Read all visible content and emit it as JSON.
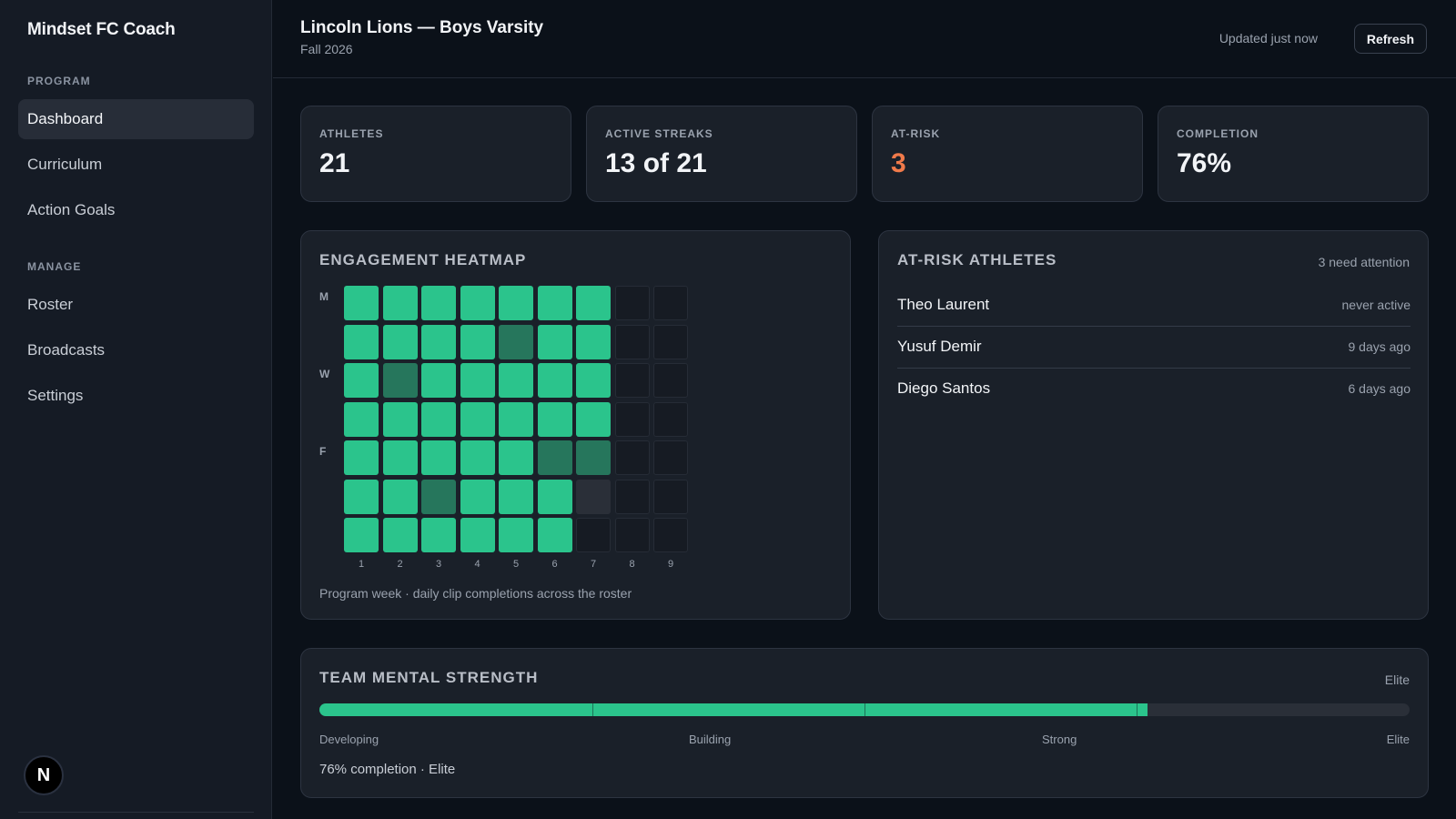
{
  "sidebar": {
    "brand": "Mindset FC Coach",
    "sections": [
      {
        "label": "PROGRAM",
        "items": [
          "Dashboard",
          "Curriculum",
          "Action Goals"
        ]
      },
      {
        "label": "MANAGE",
        "items": [
          "Roster",
          "Broadcasts",
          "Settings"
        ]
      }
    ],
    "active_item": "Dashboard",
    "avatar_initial": "N"
  },
  "header": {
    "title": "Lincoln Lions — Boys Varsity",
    "subtitle": "Fall 2026",
    "updated": "Updated just now",
    "refresh_label": "Refresh"
  },
  "stats": [
    {
      "label": "ATHLETES",
      "value": "21"
    },
    {
      "label": "ACTIVE STREAKS",
      "value": "13 of 21"
    },
    {
      "label": "AT-RISK",
      "value": "3"
    },
    {
      "label": "COMPLETION",
      "value": "76%"
    }
  ],
  "heatmap": {
    "title": "ENGAGEMENT HEATMAP",
    "day_labels": [
      "M",
      "",
      "W",
      "",
      "F",
      "",
      ""
    ],
    "week_labels": [
      "1",
      "2",
      "3",
      "4",
      "5",
      "6",
      "7",
      "8",
      "9"
    ],
    "levels": [
      [
        2,
        2,
        2,
        2,
        2,
        2,
        2,
        -1,
        -1
      ],
      [
        2,
        2,
        2,
        2,
        1,
        2,
        2,
        -1,
        -1
      ],
      [
        2,
        1,
        2,
        2,
        2,
        2,
        2,
        -1,
        -1
      ],
      [
        2,
        2,
        2,
        2,
        2,
        2,
        2,
        -1,
        -1
      ],
      [
        2,
        2,
        2,
        2,
        2,
        1,
        1,
        -1,
        -1
      ],
      [
        2,
        2,
        1,
        2,
        2,
        2,
        0,
        -1,
        -1
      ],
      [
        2,
        2,
        2,
        2,
        2,
        2,
        -1,
        -1,
        -1
      ]
    ],
    "caption": "Program week · daily clip completions across the roster"
  },
  "at_risk": {
    "title": "AT-RISK ATHLETES",
    "summary": "3 need attention",
    "athletes": [
      {
        "name": "Theo Laurent",
        "last_active": "never active"
      },
      {
        "name": "Yusuf Demir",
        "last_active": "9 days ago"
      },
      {
        "name": "Diego Santos",
        "last_active": "6 days ago"
      }
    ]
  },
  "strength": {
    "title": "TEAM MENTAL STRENGTH",
    "current_tier": "Elite",
    "progress_percent": 76,
    "tiers": [
      "Developing",
      "Building",
      "Strong",
      "Elite"
    ],
    "summary": "76% completion · Elite"
  },
  "colors": {
    "accent": "#2bc48c",
    "warning": "#f07a4a"
  }
}
